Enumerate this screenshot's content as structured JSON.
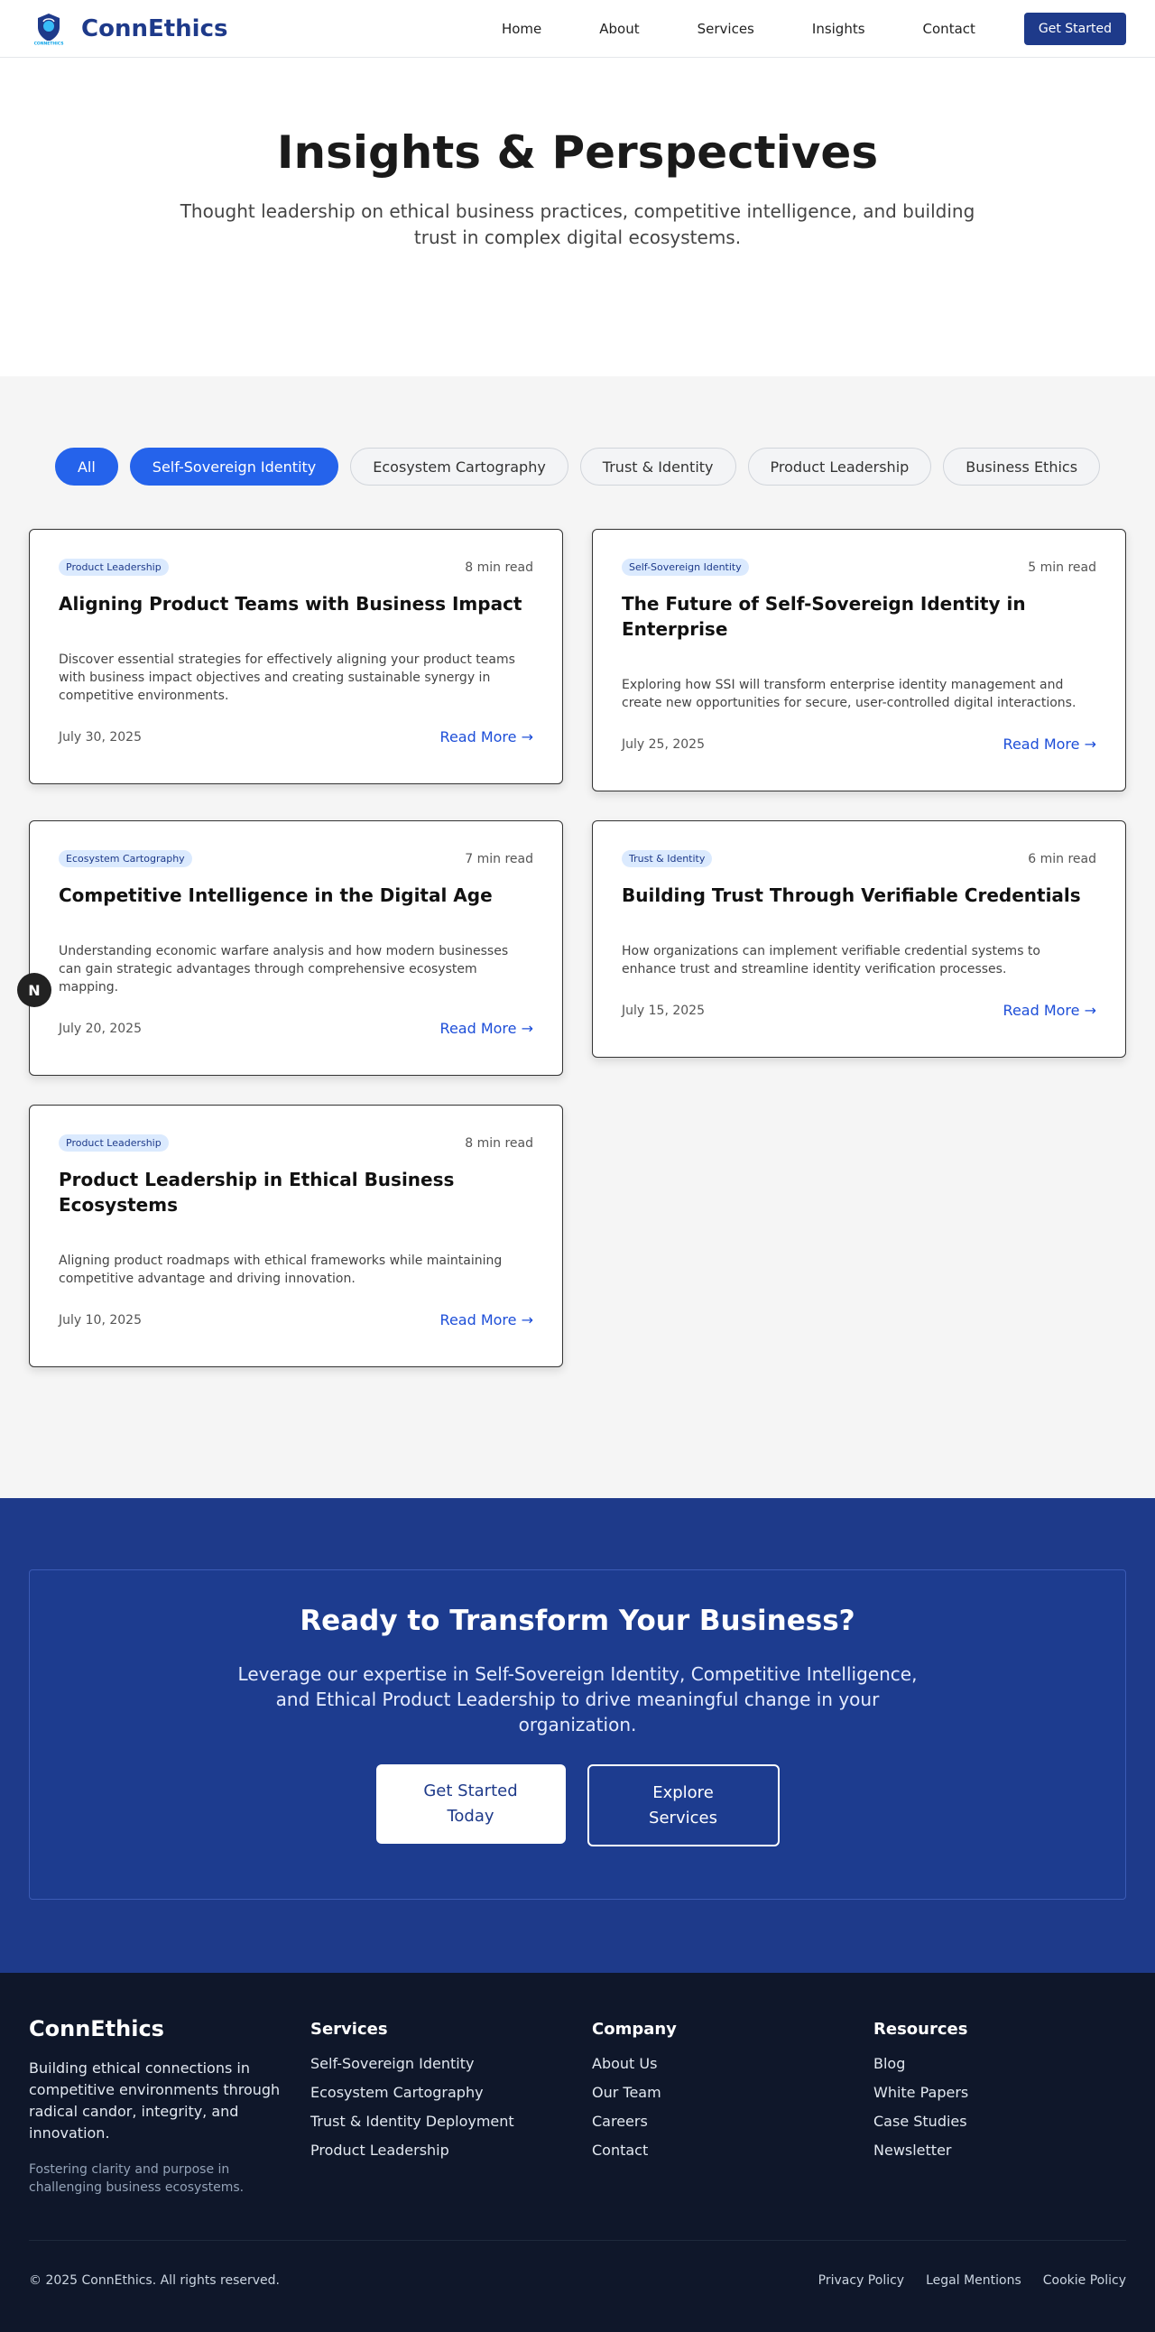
{
  "header": {
    "brand": "ConnEthics",
    "logo_text": "CONNETHICS",
    "nav": [
      "Home",
      "About",
      "Services",
      "Insights",
      "Contact"
    ],
    "cta": "Get Started"
  },
  "hero": {
    "title": "Insights & Perspectives",
    "subtitle": "Thought leadership on ethical business practices, competitive intelligence, and building trust in complex digital ecosystems."
  },
  "filters": [
    {
      "label": "All",
      "active": true
    },
    {
      "label": "Self-Sovereign Identity",
      "active": true
    },
    {
      "label": "Ecosystem Cartography",
      "active": false
    },
    {
      "label": "Trust & Identity",
      "active": false
    },
    {
      "label": "Product Leadership",
      "active": false
    },
    {
      "label": "Business Ethics",
      "active": false
    }
  ],
  "floating_button": "N",
  "articles": [
    {
      "tag": "Product Leadership",
      "read_time": "8 min read",
      "title": "Aligning Product Teams with Business Impact",
      "description": "Discover essential strategies for effectively aligning your product teams with business impact objectives and creating sustainable synergy in competitive environments.",
      "date": "July 30, 2025",
      "link": "Read More →"
    },
    {
      "tag": "Self-Sovereign Identity",
      "read_time": "5 min read",
      "title": "The Future of Self-Sovereign Identity in Enterprise",
      "description": "Exploring how SSI will transform enterprise identity management and create new opportunities for secure, user-controlled digital interactions.",
      "date": "July 25, 2025",
      "link": "Read More →"
    },
    {
      "tag": "Ecosystem Cartography",
      "read_time": "7 min read",
      "title": "Competitive Intelligence in the Digital Age",
      "description": "Understanding economic warfare analysis and how modern businesses can gain strategic advantages through comprehensive ecosystem mapping.",
      "date": "July 20, 2025",
      "link": "Read More →"
    },
    {
      "tag": "Trust & Identity",
      "read_time": "6 min read",
      "title": "Building Trust Through Verifiable Credentials",
      "description": "How organizations can implement verifiable credential systems to enhance trust and streamline identity verification processes.",
      "date": "July 15, 2025",
      "link": "Read More →"
    },
    {
      "tag": "Product Leadership",
      "read_time": "8 min read",
      "title": "Product Leadership in Ethical Business Ecosystems",
      "description": "Aligning product roadmaps with ethical frameworks while maintaining competitive advantage and driving innovation.",
      "date": "July 10, 2025",
      "link": "Read More →"
    }
  ],
  "cta": {
    "title": "Ready to Transform Your Business?",
    "text": "Leverage our expertise in Self-Sovereign Identity, Competitive Intelligence, and Ethical Product Leadership to drive meaningful change in your organization.",
    "primary": "Get Started Today",
    "secondary": "Explore Services"
  },
  "footer": {
    "brand": "ConnEthics",
    "description": "Building ethical connections in competitive environments through radical candor, integrity, and innovation.",
    "tagline": "Fostering clarity and purpose in challenging business ecosystems.",
    "columns": [
      {
        "heading": "Services",
        "links": [
          "Self-Sovereign Identity",
          "Ecosystem Cartography",
          "Trust & Identity Deployment",
          "Product Leadership"
        ]
      },
      {
        "heading": "Company",
        "links": [
          "About Us",
          "Our Team",
          "Careers",
          "Contact"
        ]
      },
      {
        "heading": "Resources",
        "links": [
          "Blog",
          "White Papers",
          "Case Studies",
          "Newsletter"
        ]
      }
    ],
    "copyright": "© 2025 ConnEthics. All rights reserved.",
    "legal": [
      "Privacy Policy",
      "Legal Mentions",
      "Cookie Policy"
    ]
  },
  "colors": {
    "brand_navy": "#1e3a8a",
    "accent_blue": "#2563eb",
    "footer_bg": "#0f172a"
  }
}
